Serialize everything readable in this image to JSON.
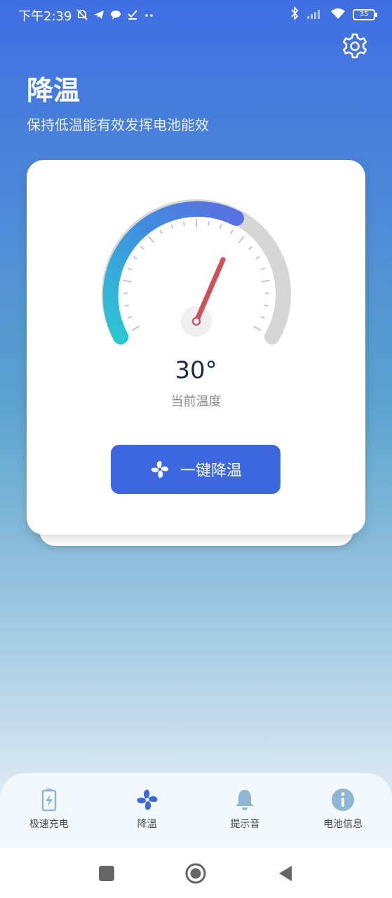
{
  "status_bar": {
    "time": "下午2:39",
    "left_icons": [
      "alarm-off-icon",
      "telegram-icon",
      "chat-icon",
      "check-icon",
      "more-dots-icon"
    ],
    "right_icons": [
      "bluetooth-icon",
      "signal-icon",
      "wifi-icon"
    ],
    "battery_level": "35"
  },
  "header": {
    "title": "降温",
    "subtitle": "保持低温能有效发挥电池能效",
    "settings_icon": "gear-icon"
  },
  "gauge": {
    "value": 30,
    "display_value": "30°",
    "label": "当前温度",
    "colors": {
      "arc_start": "#2bc7d4",
      "arc_end": "#5a6fe0",
      "track": "#d4d4d4",
      "needle": "#d0505a"
    }
  },
  "cool_button": {
    "label": "一键降温",
    "icon": "fan-icon",
    "color": "#3c67df"
  },
  "bottom_nav": {
    "items": [
      {
        "label": "极速充电",
        "icon": "battery-charge-icon",
        "active": false
      },
      {
        "label": "降温",
        "icon": "fan-icon",
        "active": true
      },
      {
        "label": "提示音",
        "icon": "bell-icon",
        "active": false
      },
      {
        "label": "电池信息",
        "icon": "info-icon",
        "active": false
      }
    ],
    "active_color": "#3c67df",
    "inactive_color": "#8fb6d4"
  },
  "system_nav": {
    "buttons": [
      "recent-apps-icon",
      "home-icon",
      "back-icon"
    ]
  }
}
